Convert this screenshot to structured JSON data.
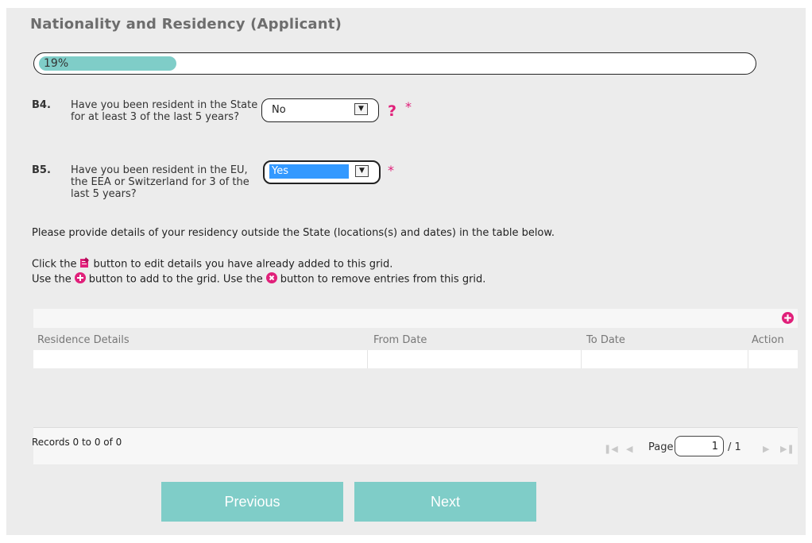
{
  "page": {
    "title": "Nationality and Residency (Applicant)"
  },
  "progress": {
    "percent_text": "19%",
    "fraction": 0.19
  },
  "questions": [
    {
      "code": "B4.",
      "text": "Have you been resident in the State for at least 3 of the last 5 years?",
      "selected": "No",
      "has_help": true,
      "help_symbol": "?",
      "required_symbol": "*"
    },
    {
      "code": "B5.",
      "text": "Have you been resident in the EU, the EEA or Switzerland for 3 of the last 5 years?",
      "selected": "Yes",
      "has_help": false,
      "required_symbol": "*"
    }
  ],
  "instructions": {
    "line1": "Please provide details of your residency outside the State (locations(s) and dates) in the table below.",
    "line2_pre": "Click the",
    "line2_post": "button to edit details you have already added to this grid.",
    "line3_pre": "Use the",
    "line3_mid": "button to add to the grid. Use the",
    "line3_post": "button to remove entries from this grid."
  },
  "grid": {
    "columns": [
      "Residence Details",
      "From Date",
      "To Date",
      "Action"
    ],
    "records_text": "Records 0 to 0 of 0",
    "page_label": "Page",
    "page_value": "1",
    "page_total": "/ 1"
  },
  "buttons": {
    "previous": "Previous",
    "next": "Next"
  },
  "colors": {
    "accent": "#7fcdc8",
    "pink": "#e0207a",
    "highlight": "#3399ff"
  }
}
